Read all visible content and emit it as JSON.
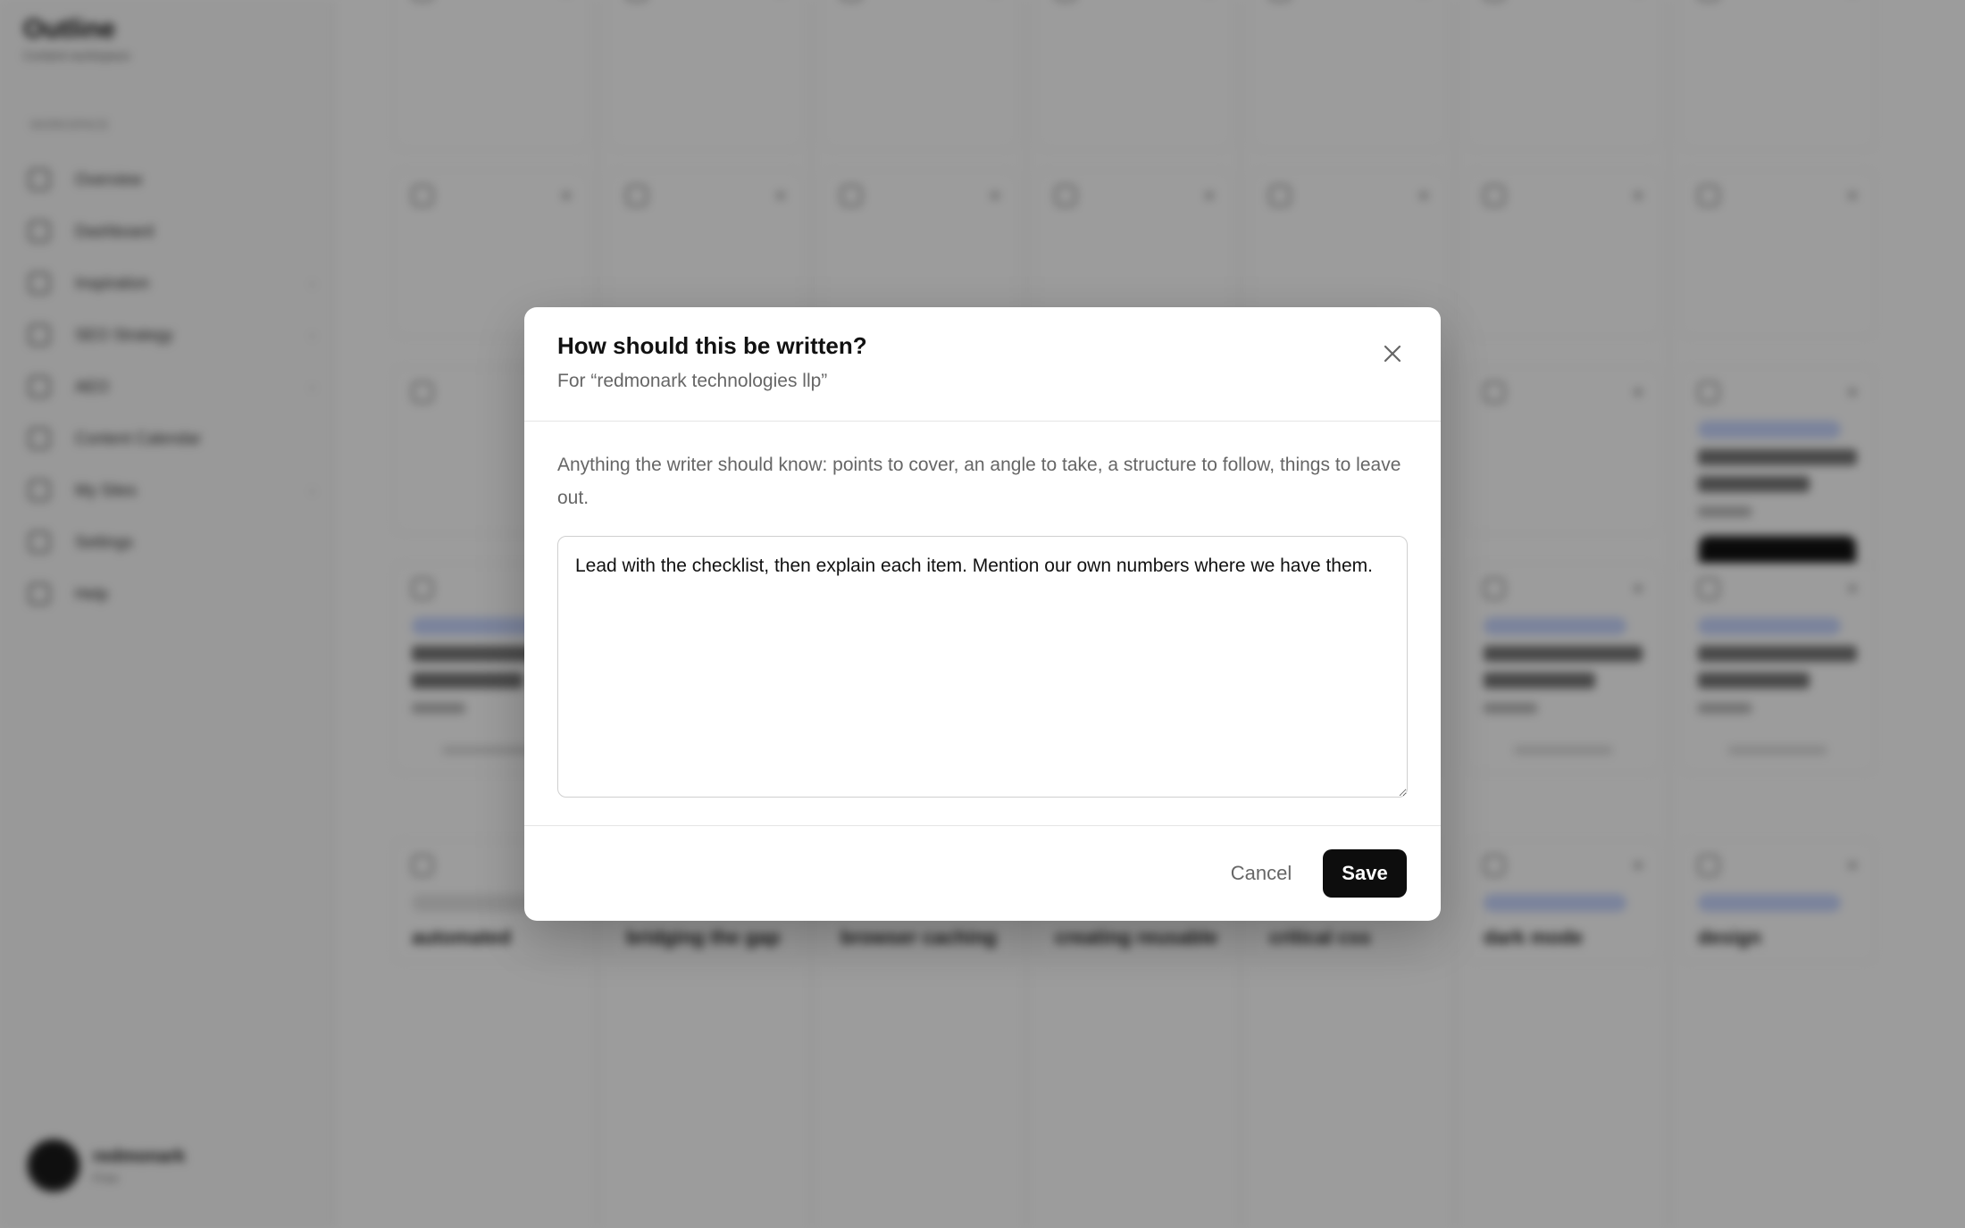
{
  "sidebar": {
    "brand_name": "Outline",
    "brand_subtitle": "Content workspace",
    "section_label": "WORKSPACE",
    "items": [
      {
        "label": "Overview",
        "icon": "grid-icon",
        "chevron": ""
      },
      {
        "label": "Dashboard",
        "icon": "dashboard-icon",
        "chevron": ""
      },
      {
        "label": "Inspiration",
        "icon": "lightbulb-icon",
        "chevron": "›"
      },
      {
        "label": "SEO Strategy",
        "icon": "chart-icon",
        "chevron": "›"
      },
      {
        "label": "AEO",
        "icon": "sparkle-icon",
        "chevron": "›"
      },
      {
        "label": "Content Calendar",
        "icon": "calendar-icon",
        "chevron": ""
      },
      {
        "label": "My Sites",
        "icon": "globe-icon",
        "chevron": "›"
      },
      {
        "label": "Settings",
        "icon": "gear-icon",
        "chevron": ""
      },
      {
        "label": "Help",
        "icon": "help-icon",
        "chevron": ""
      }
    ],
    "user_name": "redmonark",
    "user_plan": "Free"
  },
  "board": {
    "bottom_titles": [
      "automated",
      "bridging the gap",
      "browser caching",
      "creating reusable",
      "critical css",
      "dark mode",
      "design"
    ]
  },
  "modal": {
    "title": "How should this be written?",
    "subtitle": "For “redmonark technologies llp”",
    "description": "Anything the writer should know: points to cover, an angle to take, a structure to follow, things to leave out.",
    "notes_value": "Lead with the checklist, then explain each item. Mention our own numbers where we have them.",
    "cancel_label": "Cancel",
    "save_label": "Save",
    "close_icon": "close-icon"
  },
  "colors": {
    "overlay": "rgba(0,0,0,0.39)",
    "primary_button": "#0d0d0d",
    "chip": "#c9d7ff"
  }
}
